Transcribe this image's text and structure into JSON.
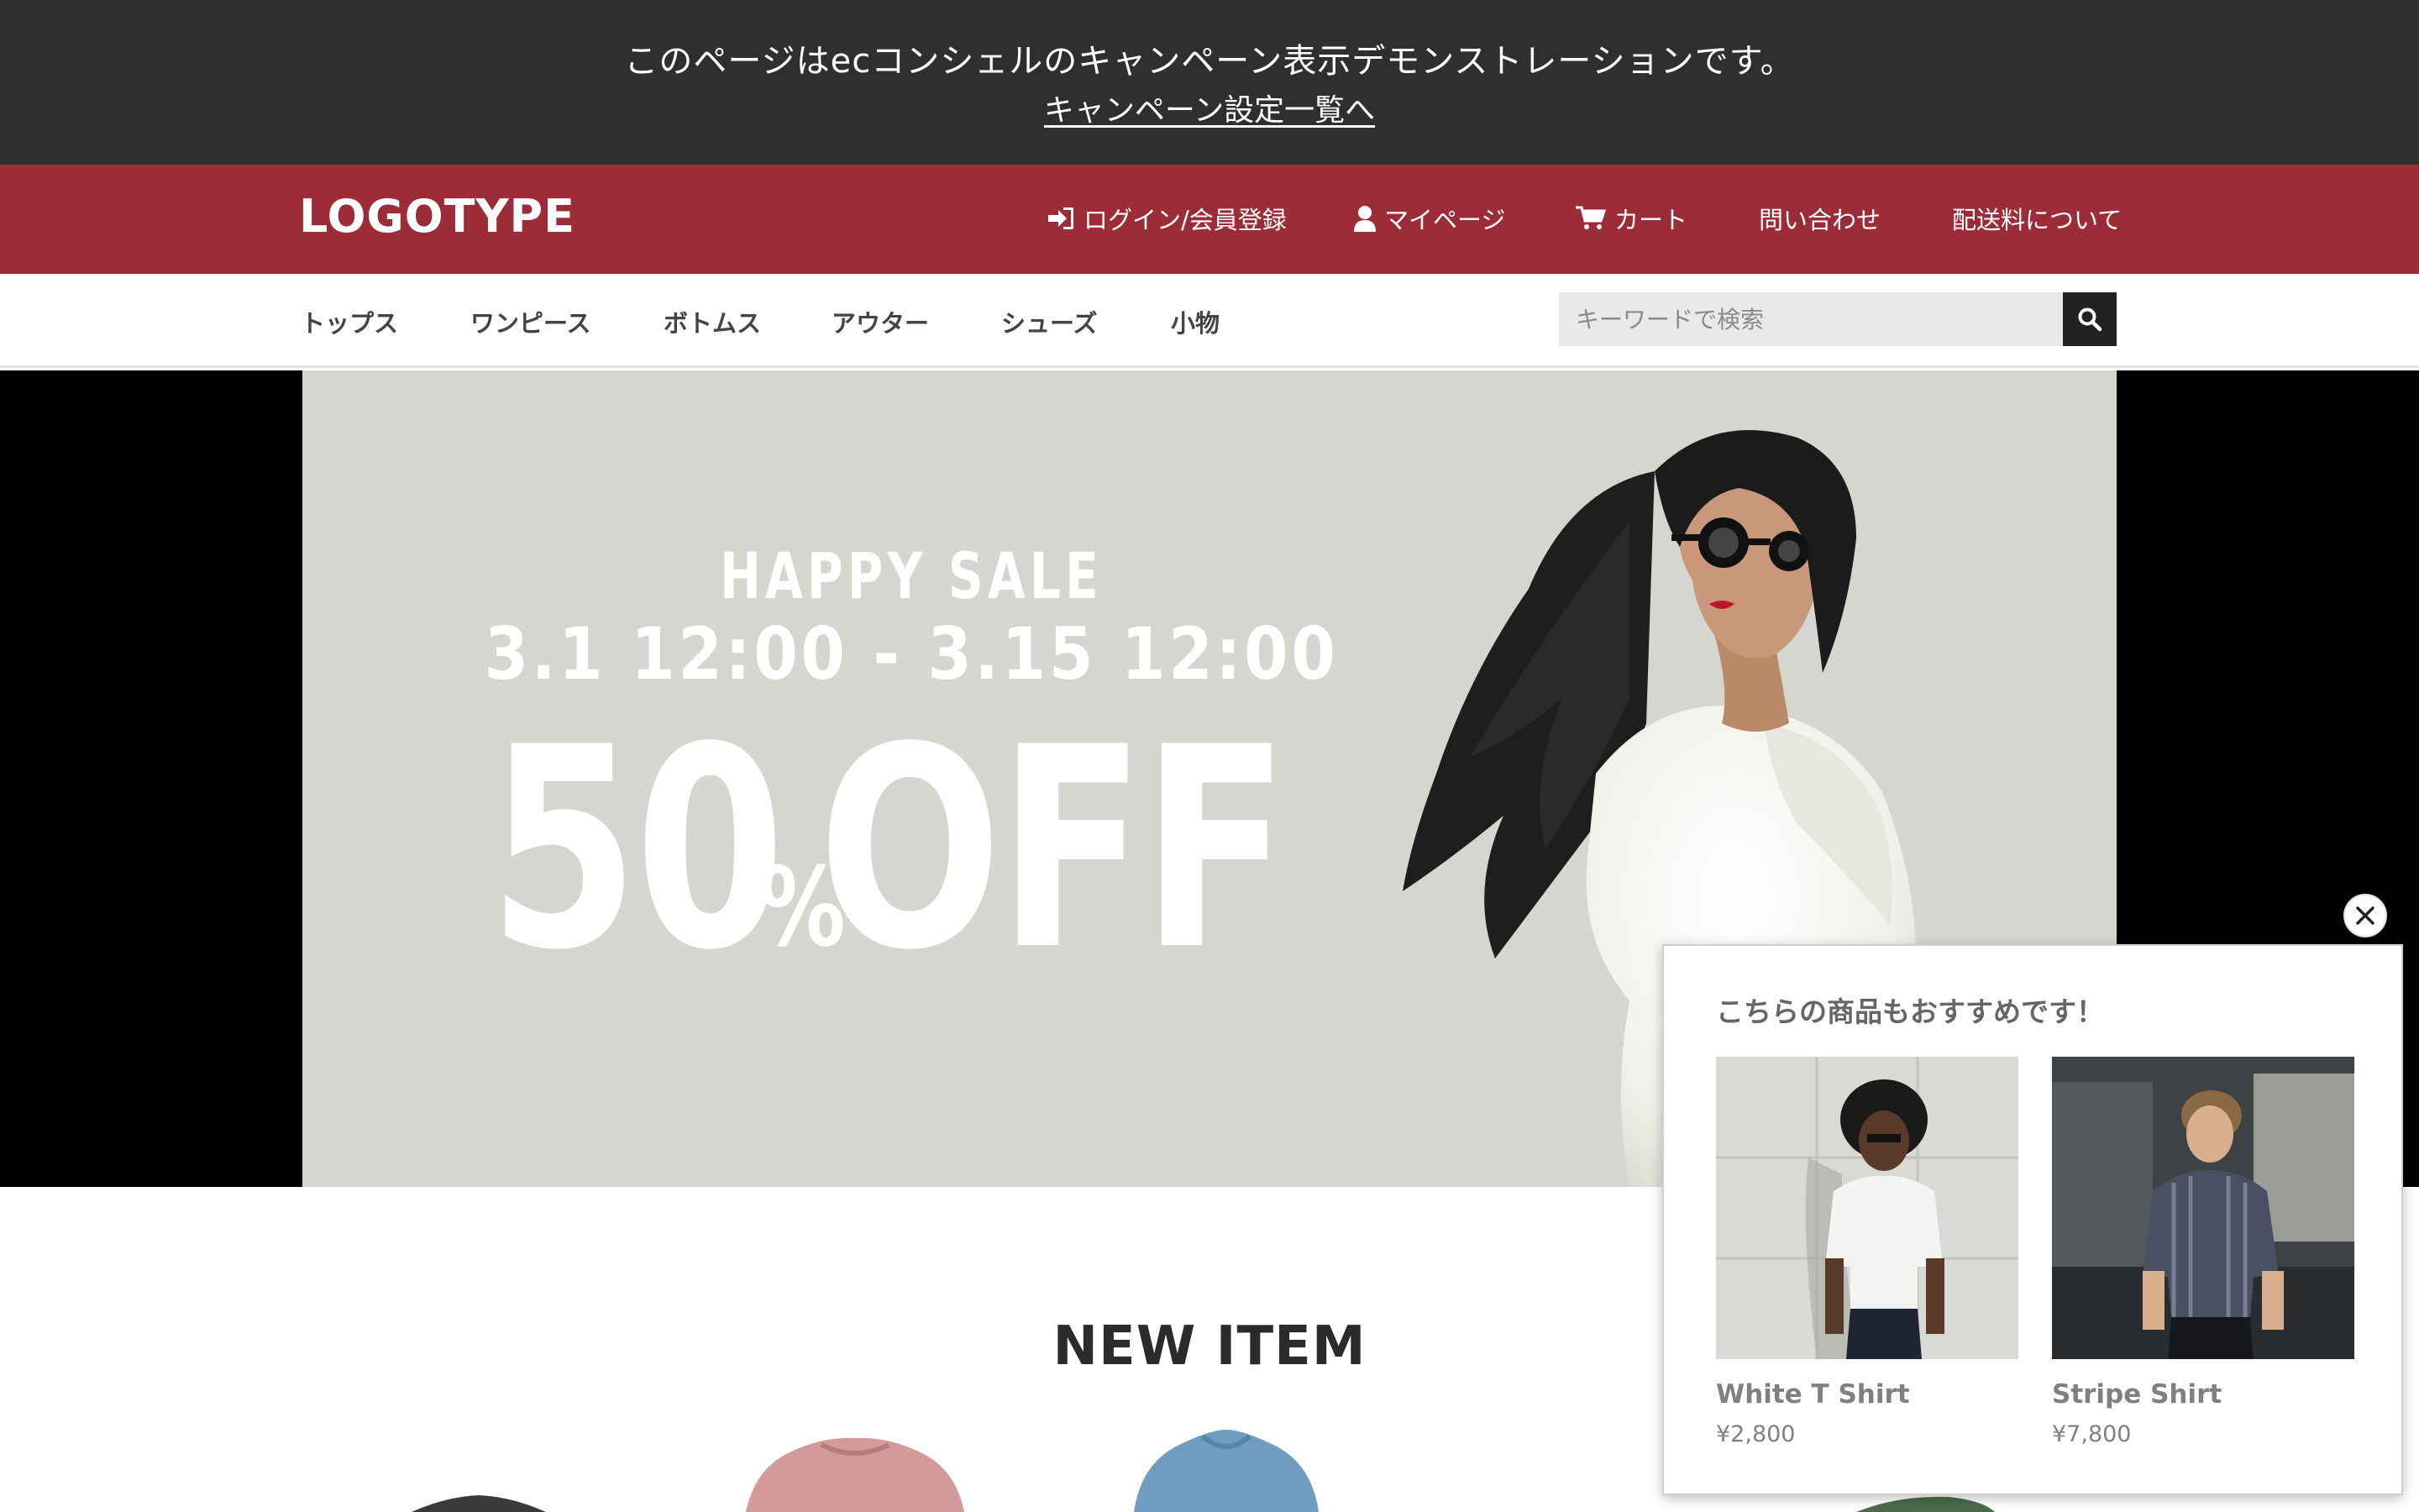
{
  "demo_banner": {
    "text": "このページはecコンシェルのキャンペーン表示デモンストレーションです。",
    "link": "キャンペーン設定一覧へ"
  },
  "header": {
    "logo": "LOGOTYPE",
    "nav": [
      {
        "label": "ログイン/会員登録",
        "icon": "login-icon"
      },
      {
        "label": "マイページ",
        "icon": "user-icon"
      },
      {
        "label": "カート",
        "icon": "cart-icon"
      },
      {
        "label": "問い合わせ",
        "icon": ""
      },
      {
        "label": "配送料について",
        "icon": ""
      }
    ]
  },
  "categories": [
    "トップス",
    "ワンピース",
    "ボトムス",
    "アウター",
    "シューズ",
    "小物"
  ],
  "search": {
    "placeholder": "キーワードで検索",
    "icon": "search-icon"
  },
  "hero": {
    "headline": "HAPPY SALE",
    "period": "3.1 12:00 - 3.15 12:00",
    "discount_number": "50",
    "discount_percent": "%",
    "discount_word": "OFF",
    "background": "#d5d6d0"
  },
  "section": {
    "title": "NEW ITEM"
  },
  "recommend": {
    "title": "こちらの商品もおすすめです！",
    "items": [
      {
        "name": "White T Shirt",
        "price": "¥2,800"
      },
      {
        "name": "Stripe Shirt",
        "price": "¥7,800"
      }
    ],
    "close_icon": "close-icon"
  },
  "colors": {
    "demo_bar": "#2f2f2f",
    "header_red": "#9c2c38",
    "search_button": "#222222"
  }
}
